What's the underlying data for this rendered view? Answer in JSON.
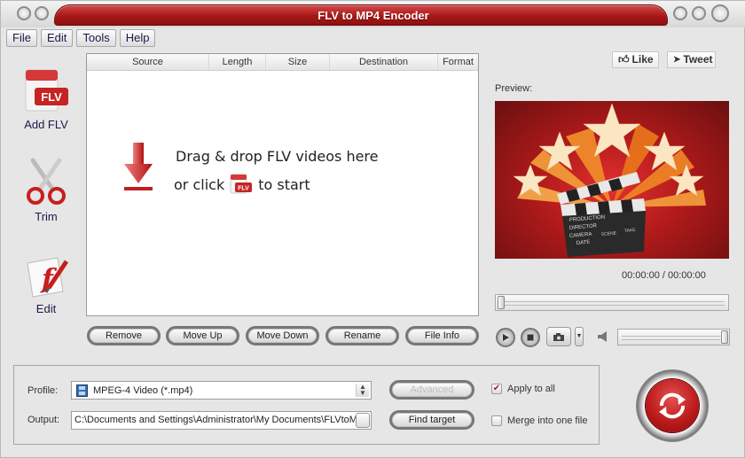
{
  "window": {
    "title": "FLV to MP4 Encoder"
  },
  "menubar": {
    "items": [
      "File",
      "Edit",
      "Tools",
      "Help"
    ]
  },
  "sidebar": {
    "items": [
      {
        "label": "Add FLV",
        "icon": "add-flv-icon"
      },
      {
        "label": "Trim",
        "icon": "scissors-icon"
      },
      {
        "label": "Edit",
        "icon": "flash-edit-icon"
      }
    ]
  },
  "filelist": {
    "columns": [
      "Source",
      "Length",
      "Size",
      "Destination",
      "Format"
    ],
    "rows": [],
    "empty_line1": "Drag & drop FLV videos here",
    "empty_line2_before": "or click",
    "empty_line2_after": "to start",
    "flv_badge": "FLV"
  },
  "list_buttons": {
    "remove": "Remove",
    "move_up": "Move Up",
    "move_down": "Move Down",
    "rename": "Rename",
    "file_info": "File Info"
  },
  "social": {
    "like": "Like",
    "tweet": "Tweet"
  },
  "preview": {
    "label": "Preview:",
    "clapper_lines": [
      "PRODUCTION",
      "DIRECTOR",
      "CAMERA",
      "DATE",
      "SCENE",
      "TAKE"
    ],
    "timecode": "00:00:00 / 00:00:00",
    "seek_position": 0,
    "volume_level": 1.0
  },
  "settings": {
    "profile_label": "Profile:",
    "profile_value": "MPEG-4 Video (*.mp4)",
    "output_label": "Output:",
    "output_value": "C:\\Documents and Settings\\Administrator\\My Documents\\FLVtoMP",
    "advanced_label": "Advanced",
    "advanced_enabled": false,
    "find_target_label": "Find target",
    "apply_to_all_label": "Apply to all",
    "apply_to_all_checked": true,
    "merge_label": "Merge into one file",
    "merge_checked": false
  },
  "colors": {
    "accent_red": "#b81818",
    "title_text": "#ffffff",
    "menu_text": "#1a1a4a"
  }
}
